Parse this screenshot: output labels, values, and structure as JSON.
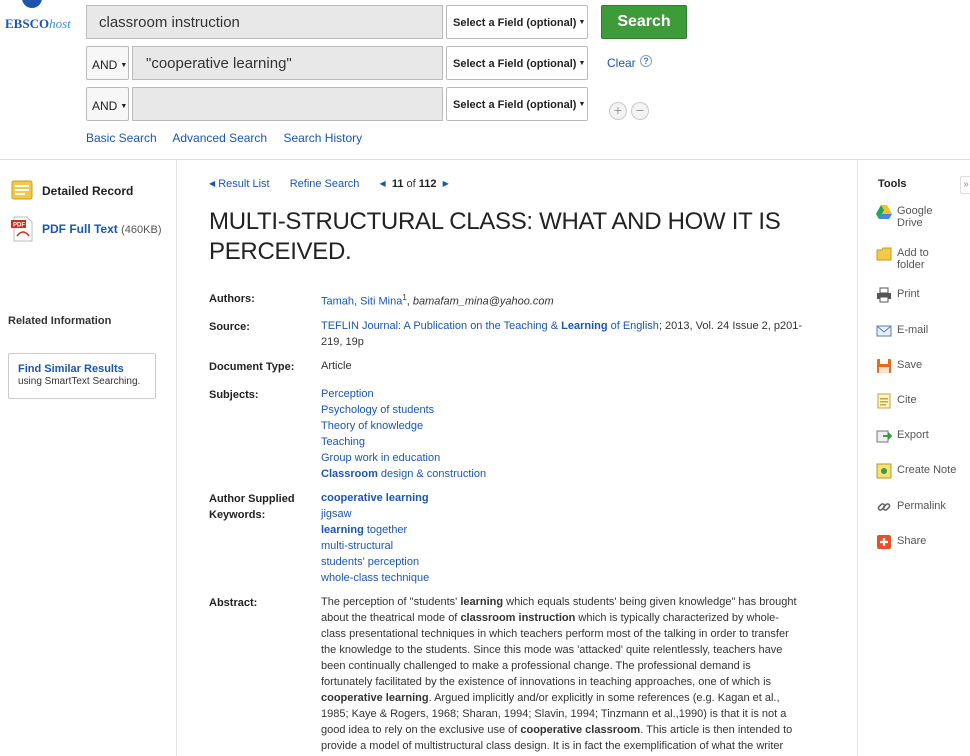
{
  "logo": {
    "brand": "EBSCO",
    "suffix": "host"
  },
  "search": {
    "rows": [
      {
        "bool": "",
        "term": "classroom instruction",
        "field": "Select a Field (optional)"
      },
      {
        "bool": "AND",
        "term": "\"cooperative learning\"",
        "field": "Select a Field (optional)"
      },
      {
        "bool": "AND",
        "term": "",
        "field": "Select a Field (optional)"
      }
    ],
    "search_label": "Search",
    "clear_label": "Clear",
    "help_glyph": "?",
    "add_glyph": "+",
    "remove_glyph": "−",
    "links": [
      "Basic Search",
      "Advanced Search",
      "Search History"
    ]
  },
  "left": {
    "detailed_record": "Detailed Record",
    "pdf_label": "PDF Full Text",
    "pdf_size": "(460KB)",
    "related_heading": "Related Information",
    "similar_title": "Find Similar Results",
    "similar_sub": "using SmartText Searching."
  },
  "nav": {
    "result_list": "Result List",
    "refine_search": "Refine Search",
    "current": "11",
    "of": "of",
    "total": "112"
  },
  "record": {
    "title": "MULTI-STRUCTURAL CLASS: WHAT AND HOW IT IS PERCEIVED.",
    "authors_label": "Authors:",
    "authors_name": "Tamah, Siti Mina",
    "authors_sup": "1",
    "authors_email": "bamafam_mina@yahoo.com",
    "source_label": "Source:",
    "source_pre": "TEFLIN Journal: A Publication on the Teaching & ",
    "source_bold": "Learning",
    "source_post": " of English",
    "source_details": "; 2013, Vol. 24 Issue 2, p201-219, 19p",
    "doctype_label": "Document Type:",
    "doctype_value": "Article",
    "subjects_label": "Subjects:",
    "subjects": [
      "Perception",
      "Psychology of students",
      "Theory of knowledge",
      "Teaching",
      "Group work in education"
    ],
    "subject_last_bold": "Classroom",
    "subject_last_rest": " design & construction",
    "keywords_label_1": "Author Supplied",
    "keywords_label_2": "Keywords:",
    "kw1": "cooperative learning",
    "kw2": "jigsaw",
    "kw3_bold": "learning",
    "kw3_rest": " together",
    "kw4": "multi-structural",
    "kw5": "students' perception",
    "kw6": "whole-class technique",
    "abstract_label": "Abstract:",
    "abstract_1": "The perception of \"students' ",
    "abstract_b1": "learning",
    "abstract_2": " which equals students' being given knowledge\" has brought about the theatrical mode of ",
    "abstract_b2": "classroom instruction",
    "abstract_3": " which is typically characterized by whole-class presentational techniques in which teachers perform most of the talking in order to transfer the knowledge to the students. Since this mode was 'attacked' quite relentlessly, teachers have been continually challenged to make a professional change. The professional demand is fortunately facilitated by the existence of innovations in teaching approaches, one of which is ",
    "abstract_b3": "cooperative learning",
    "abstract_4": ". Argued implicitly and/or explicitly in some references (e.g. Kagan et al., 1985; Kaye & Rogers, 1968; Sharan, 1994; Slavin, 1994; Tinzmann et al.,1990) is that it is not a good idea to rely on the exclusive use of ",
    "abstract_b4": "cooperative classroom",
    "abstract_5": ". This article is then intended to provide a model of multistructural class design. It is in fact the exemplification of what the writer has implemented in her reading class of university students. Simply"
  },
  "tools": {
    "heading": "Tools",
    "collapse_glyph": "»",
    "items": [
      "Google Drive",
      "Add to folder",
      "Print",
      "E-mail",
      "Save",
      "Cite",
      "Export",
      "Create Note",
      "Permalink",
      "Share"
    ]
  },
  "colors": {
    "link": "#1a56b0",
    "search_button": "#3e9b3a",
    "brand": "#1d56a8"
  }
}
